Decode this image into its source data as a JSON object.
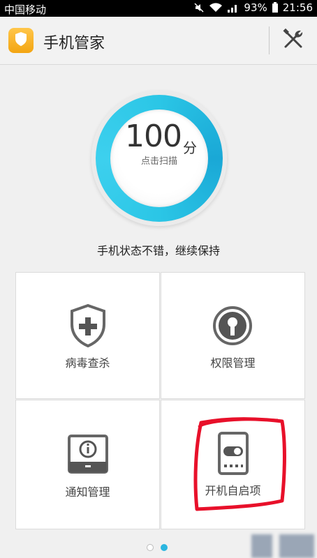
{
  "status_bar": {
    "carrier": "中国移动",
    "battery": "93%",
    "time": "21:56"
  },
  "header": {
    "title": "手机管家",
    "logo_icon": "shield-icon",
    "tools_icon": "tools-icon"
  },
  "score": {
    "value": "100",
    "unit": "分",
    "action": "点击扫描",
    "message": "手机状态不错，继续保持"
  },
  "tiles": [
    {
      "label": "病毒查杀",
      "icon": "shield-plus-icon"
    },
    {
      "label": "权限管理",
      "icon": "keyhole-icon"
    },
    {
      "label": "通知管理",
      "icon": "notification-icon"
    },
    {
      "label": "开机自启项",
      "icon": "startup-toggle-icon"
    }
  ],
  "pager": {
    "pages": 2,
    "active_index": 1
  },
  "colors": {
    "accent": "#2bc6e6",
    "logo": "#f5a814",
    "annotation": "#e8102a"
  }
}
